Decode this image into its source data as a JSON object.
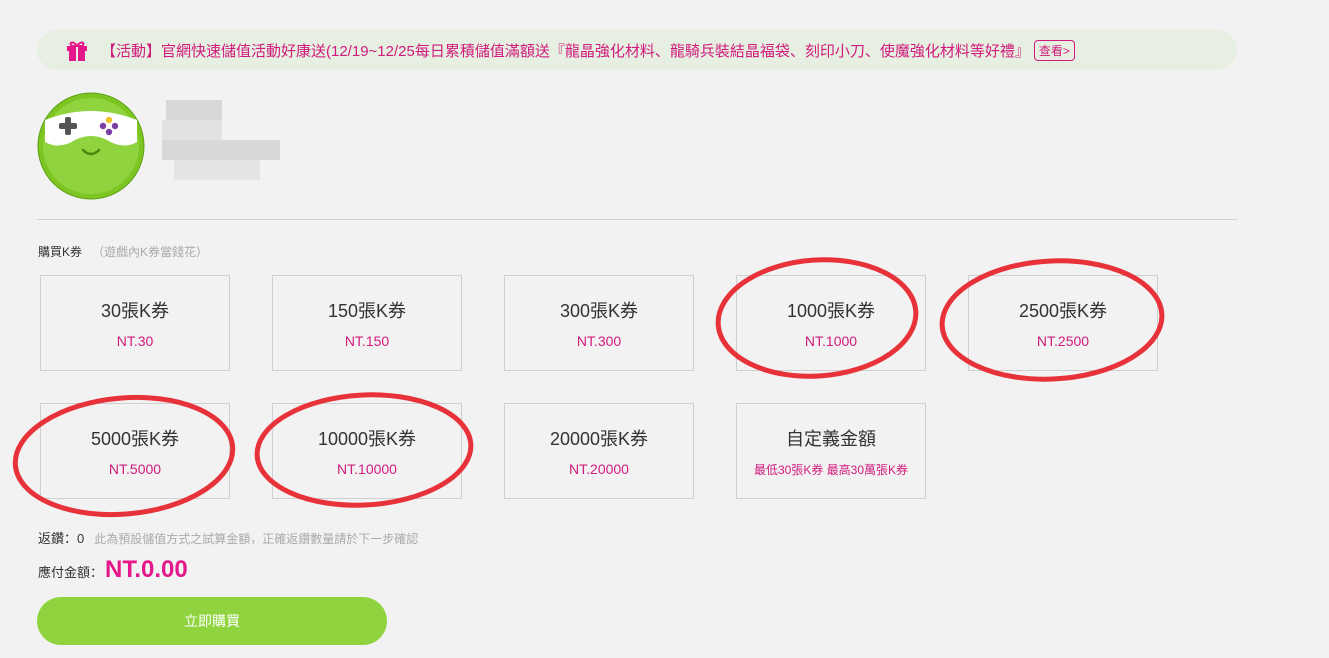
{
  "banner": {
    "text": "【活動】官網快速儲值活動好康送(12/19~12/25每日累積儲值滿額送『龍晶強化材料、龍騎兵裝結晶福袋、刻印小刀、使魔強化材料等好禮』",
    "more_label": "查看>",
    "accent_color": "#d11b7c"
  },
  "section": {
    "label": "購買K券",
    "note": "（遊戲內K券當錢花）"
  },
  "packages": [
    {
      "title": "30張K券",
      "price": "NT.30"
    },
    {
      "title": "150張K券",
      "price": "NT.150"
    },
    {
      "title": "300張K券",
      "price": "NT.300"
    },
    {
      "title": "1000張K券",
      "price": "NT.1000"
    },
    {
      "title": "2500張K券",
      "price": "NT.2500"
    },
    {
      "title": "5000張K券",
      "price": "NT.5000"
    },
    {
      "title": "10000張K券",
      "price": "NT.10000"
    },
    {
      "title": "20000張K券",
      "price": "NT.20000"
    },
    {
      "title": "自定義金額",
      "price": "最低30張K券 最高30萬張K券"
    }
  ],
  "rebate": {
    "label": "返鑽：",
    "value": "0",
    "hint": "此為預設儲值方式之試算金額，正確返鑽數量請於下一步確認"
  },
  "amount": {
    "label": "應付金額：",
    "value": "NT.0.00"
  },
  "buy_button": {
    "label": "立即購買"
  },
  "icons": {
    "banner_icon": "gift-icon",
    "avatar": "gamepad-mascot-icon"
  },
  "colors": {
    "price": "#d11b7c",
    "button": "#8fd43f",
    "annotation": "#e8323a"
  }
}
